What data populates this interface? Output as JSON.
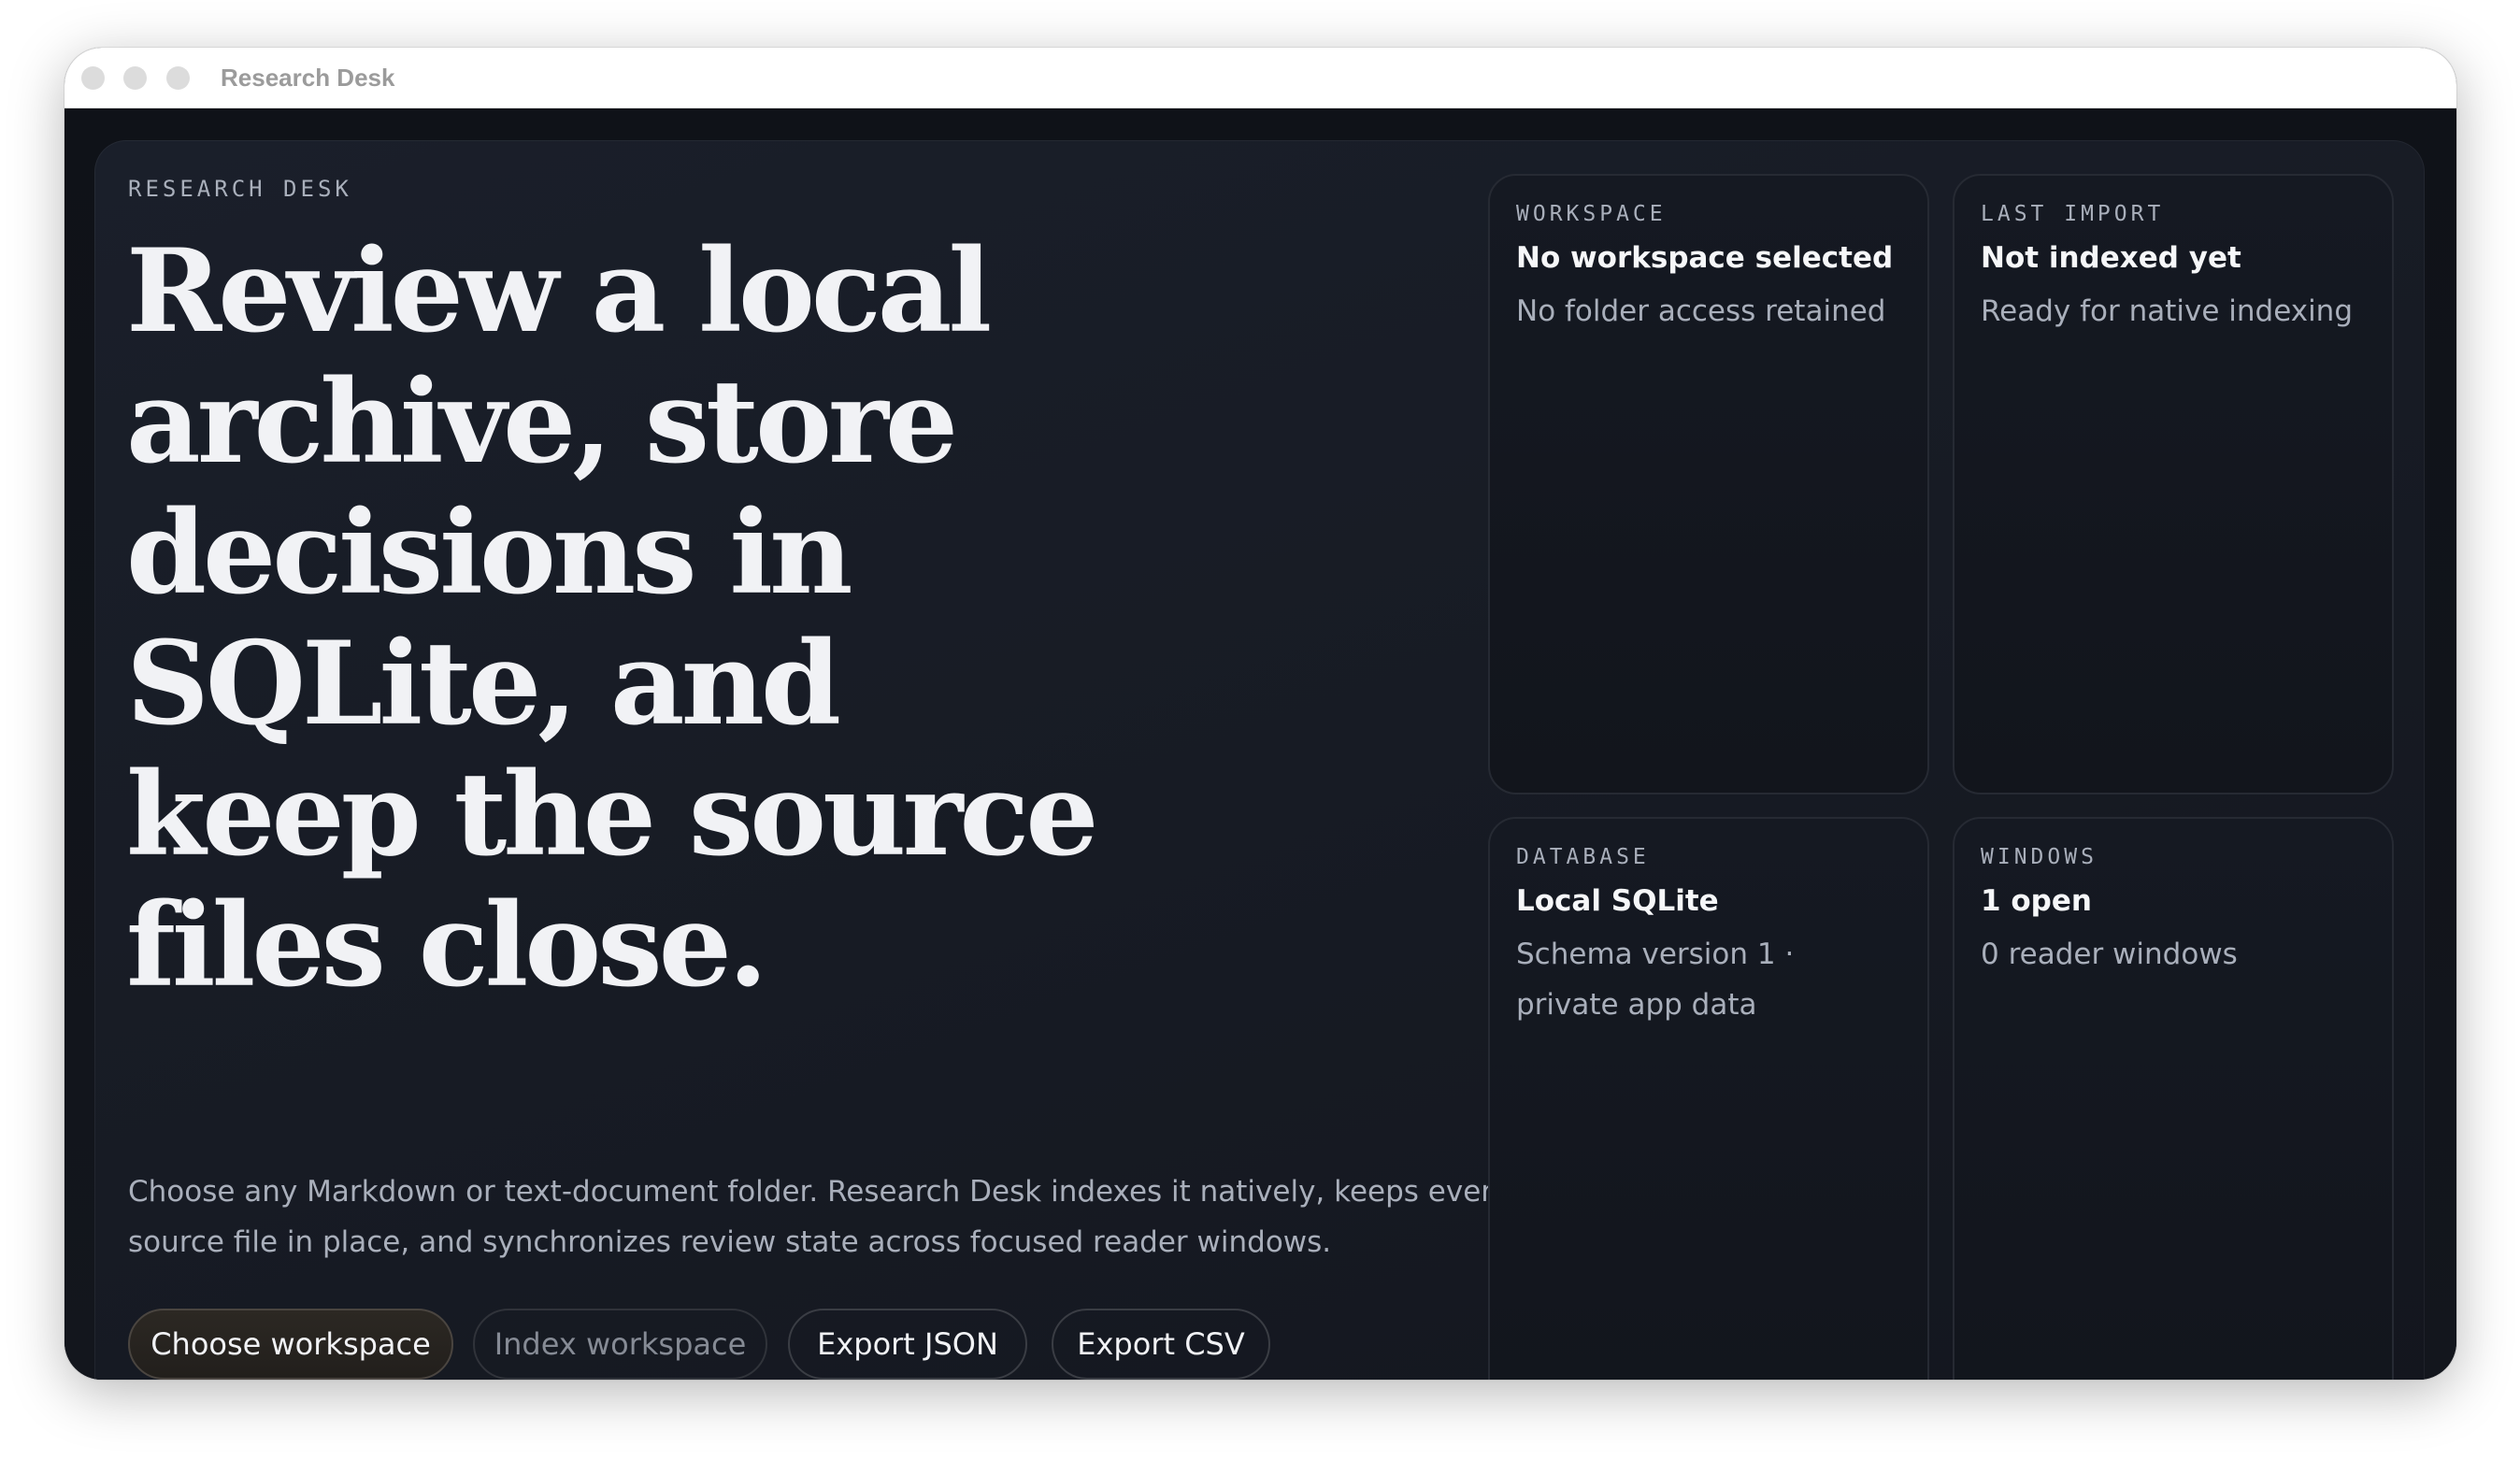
{
  "window": {
    "title": "Research Desk"
  },
  "hero": {
    "eyebrow": "RESEARCH DESK",
    "headline": "Review a local archive, store decisions in SQLite, and keep the source files close.",
    "description": "Choose any Markdown or text-document folder. Research Desk indexes it natively, keeps every source file in place, and synchronizes review state across focused reader windows."
  },
  "actions": {
    "choose_workspace": "Choose workspace",
    "index_workspace": "Index workspace",
    "export_json": "Export JSON",
    "export_csv": "Export CSV"
  },
  "cards": {
    "workspace": {
      "label": "WORKSPACE",
      "value": "No workspace selected",
      "detail": "No folder access retained"
    },
    "last_import": {
      "label": "LAST IMPORT",
      "value": "Not indexed yet",
      "detail": "Ready for native indexing"
    },
    "database": {
      "label": "DATABASE",
      "value": "Local SQLite",
      "detail": "Schema version 1 · private app data"
    },
    "windows": {
      "label": "WINDOWS",
      "value": "1 open",
      "detail": "0 reader windows"
    }
  },
  "colors": {
    "background": "#12151c",
    "panel": "#1a1f2a",
    "text_primary": "#f1f2f5",
    "text_secondary": "#a9afbb",
    "primary_button": "#2c2823"
  }
}
